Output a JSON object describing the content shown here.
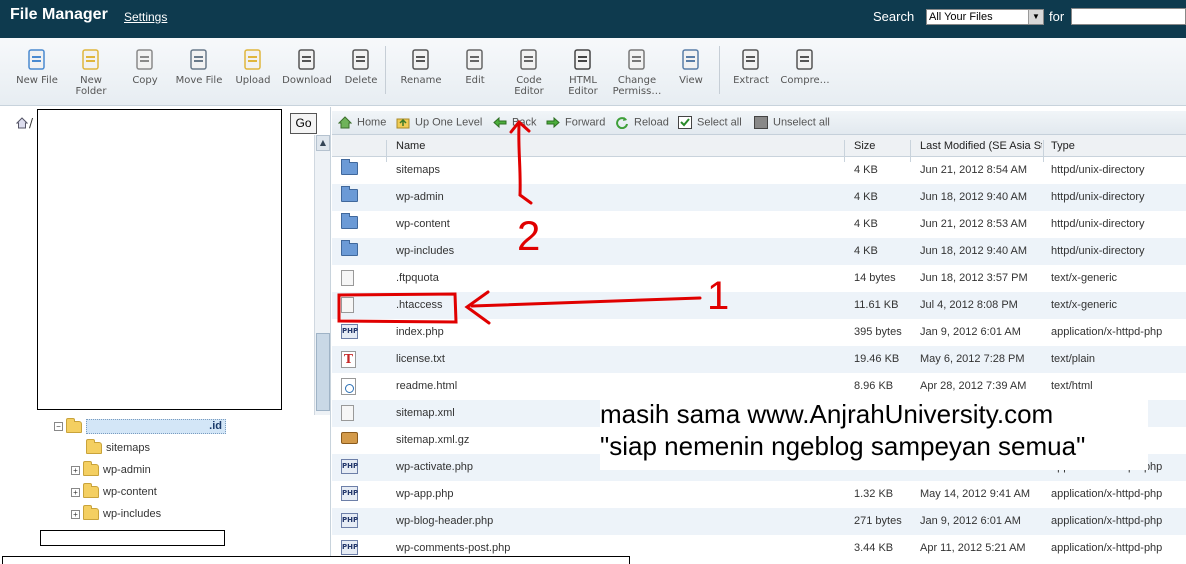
{
  "header": {
    "title": "File Manager",
    "settings_label": "Settings",
    "search_label": "Search",
    "search_scope": "All Your Files",
    "for_label": "for",
    "search_value": ""
  },
  "toolbar": {
    "buttons": [
      {
        "label": "New File",
        "icon": "new-file-icon"
      },
      {
        "label": "New Folder",
        "icon": "new-folder-icon"
      },
      {
        "label": "Copy",
        "icon": "copy-icon"
      },
      {
        "label": "Move File",
        "icon": "move-file-icon"
      },
      {
        "label": "Upload",
        "icon": "upload-icon"
      },
      {
        "label": "Download",
        "icon": "download-icon"
      },
      {
        "label": "Delete",
        "icon": "delete-icon"
      },
      {
        "label": "Rename",
        "icon": "rename-icon"
      },
      {
        "label": "Edit",
        "icon": "edit-icon"
      },
      {
        "label": "Code Editor",
        "icon": "code-editor-icon"
      },
      {
        "label": "HTML Editor",
        "icon": "html-editor-icon"
      },
      {
        "label": "Change Permiss…",
        "icon": "permissions-icon"
      },
      {
        "label": "View",
        "icon": "view-icon"
      },
      {
        "label": "Extract",
        "icon": "extract-icon"
      },
      {
        "label": "Compre…",
        "icon": "compress-icon"
      }
    ]
  },
  "tree": {
    "path_prefix": "/",
    "go_label": "Go",
    "root_suffix": ".id",
    "children": [
      "sitemaps",
      "wp-admin",
      "wp-content",
      "wp-includes"
    ]
  },
  "nav": {
    "home": "Home",
    "up": "Up One Level",
    "back": "Back",
    "forward": "Forward",
    "reload": "Reload",
    "select_all": "Select all",
    "unselect_all": "Unselect all"
  },
  "table": {
    "columns": {
      "name": "Name",
      "size": "Size",
      "modified": "Last Modified (SE Asia St",
      "type": "Type"
    },
    "rows": [
      {
        "icon": "folder-icon",
        "name": "sitemaps",
        "size": "4 KB",
        "modified": "Jun 21, 2012 8:54 AM",
        "type": "httpd/unix-directory"
      },
      {
        "icon": "folder-icon",
        "name": "wp-admin",
        "size": "4 KB",
        "modified": "Jun 18, 2012 9:40 AM",
        "type": "httpd/unix-directory"
      },
      {
        "icon": "folder-icon",
        "name": "wp-content",
        "size": "4 KB",
        "modified": "Jun 21, 2012 8:53 AM",
        "type": "httpd/unix-directory"
      },
      {
        "icon": "folder-icon",
        "name": "wp-includes",
        "size": "4 KB",
        "modified": "Jun 18, 2012 9:40 AM",
        "type": "httpd/unix-directory"
      },
      {
        "icon": "text-file-icon",
        "name": ".ftpquota",
        "size": "14 bytes",
        "modified": "Jun 18, 2012 3:57 PM",
        "type": "text/x-generic"
      },
      {
        "icon": "text-file-icon",
        "name": ".htaccess",
        "size": "11.61 KB",
        "modified": "Jul 4, 2012 8:08 PM",
        "type": "text/x-generic"
      },
      {
        "icon": "php-file-icon",
        "name": "index.php",
        "size": "395 bytes",
        "modified": "Jan 9, 2012 6:01 AM",
        "type": "application/x-httpd-php"
      },
      {
        "icon": "license-file-icon",
        "name": "license.txt",
        "size": "19.46 KB",
        "modified": "May 6, 2012 7:28 PM",
        "type": "text/plain"
      },
      {
        "icon": "html-file-icon",
        "name": "readme.html",
        "size": "8.96 KB",
        "modified": "Apr 28, 2012 7:39 AM",
        "type": "text/html"
      },
      {
        "icon": "text-file-icon",
        "name": "sitemap.xml",
        "size": "",
        "modified": "",
        "type": ""
      },
      {
        "icon": "archive-file-icon",
        "name": "sitemap.xml.gz",
        "size": "",
        "modified": "",
        "type": ""
      },
      {
        "icon": "php-file-icon",
        "name": "wp-activate.php",
        "size": "",
        "modified": "",
        "type": "application/x-httpd-php"
      },
      {
        "icon": "php-file-icon",
        "name": "wp-app.php",
        "size": "1.32 KB",
        "modified": "May 14, 2012 9:41 AM",
        "type": "application/x-httpd-php"
      },
      {
        "icon": "php-file-icon",
        "name": "wp-blog-header.php",
        "size": "271 bytes",
        "modified": "Jan 9, 2012 6:01 AM",
        "type": "application/x-httpd-php"
      },
      {
        "icon": "php-file-icon",
        "name": "wp-comments-post.php",
        "size": "3.44 KB",
        "modified": "Apr 11, 2012 5:21 AM",
        "type": "application/x-httpd-php"
      }
    ]
  },
  "annotation": {
    "line1": "masih sama www.AnjrahUniversity.com",
    "line2": "\"siap nemenin ngeblog sampeyan semua\"",
    "mark1": "1",
    "mark2": "2",
    "color": "#e00000"
  }
}
